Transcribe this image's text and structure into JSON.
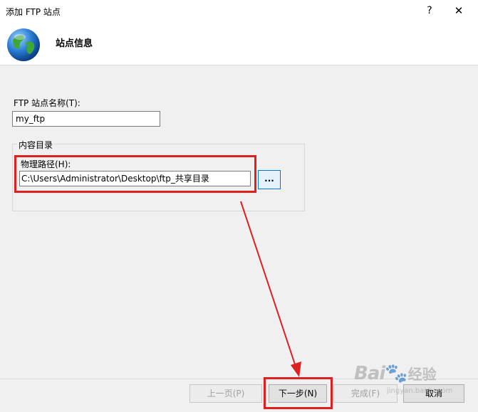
{
  "window": {
    "title": "添加 FTP 站点",
    "help_label": "?",
    "close_label": "✕"
  },
  "header": {
    "title": "站点信息"
  },
  "form": {
    "site_name_label": "FTP 站点名称(T):",
    "site_name_value": "my_ftp",
    "content_group_label": "内容目录",
    "physical_path_label": "物理路径(H):",
    "physical_path_value": "C:\\Users\\Administrator\\Desktop\\ftp_共享目录",
    "browse_label": "..."
  },
  "buttons": {
    "prev": "上一页(P)",
    "next": "下一步(N)",
    "finish": "完成(F)",
    "cancel": "取消"
  },
  "watermark": {
    "brand": "Bai",
    "brand2": "经验",
    "sub": "jingyan.baidu.com"
  },
  "colors": {
    "annotation_red": "#e02020",
    "accent_blue": "#0078d7"
  }
}
